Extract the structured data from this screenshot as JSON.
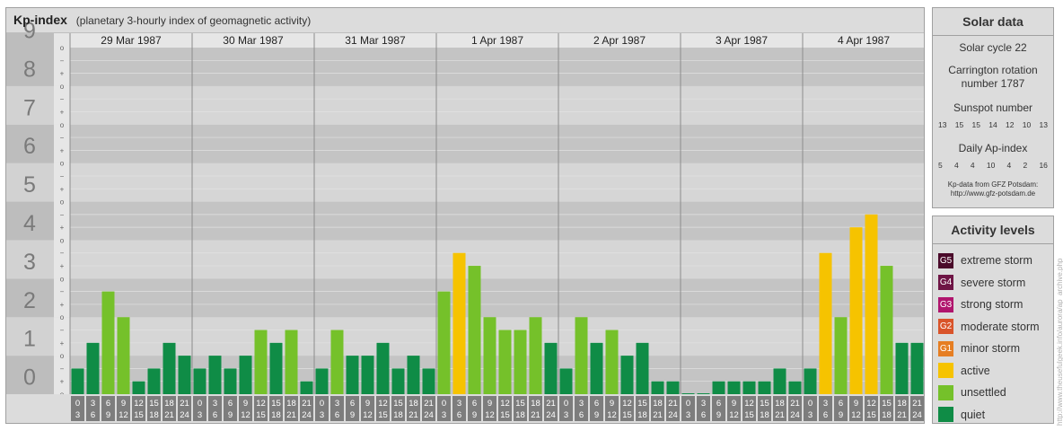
{
  "header": {
    "title": "Kp-index",
    "subtitle": "(planetary 3-hourly index of geomagnetic activity)"
  },
  "chart_data": {
    "type": "bar",
    "ylim": [
      0,
      9
    ],
    "y_major_ticks": [
      "0",
      "1",
      "2",
      "3",
      "4",
      "5",
      "6",
      "7",
      "8",
      "9"
    ],
    "y_minor_ticks": [
      "−",
      "o",
      "+"
    ],
    "days": [
      "29 Mar 1987",
      "30 Mar 1987",
      "31 Mar 1987",
      "1 Apr 1987",
      "2 Apr 1987",
      "3 Apr 1987",
      "4 Apr 1987"
    ],
    "hour_ticks_top": [
      "0",
      "3",
      "6",
      "9",
      "12",
      "15",
      "18",
      "21"
    ],
    "hour_ticks_bottom": [
      "3",
      "6",
      "9",
      "12",
      "15",
      "18",
      "21",
      "24"
    ],
    "values": [
      [
        0.667,
        1.333,
        2.667,
        2.0,
        0.333,
        0.667,
        1.333,
        1.0
      ],
      [
        0.667,
        1.0,
        0.667,
        1.0,
        1.667,
        1.333,
        1.667,
        0.333
      ],
      [
        0.667,
        1.667,
        1.0,
        1.0,
        1.333,
        0.667,
        1.0,
        0.667
      ],
      [
        2.667,
        3.667,
        3.333,
        2.0,
        1.667,
        1.667,
        2.0,
        1.333
      ],
      [
        0.667,
        2.0,
        1.333,
        1.667,
        1.0,
        1.333,
        0.333,
        0.333
      ],
      [
        0.0,
        0.0,
        0.333,
        0.333,
        0.333,
        0.333,
        0.667,
        0.333
      ],
      [
        0.667,
        3.667,
        2.0,
        4.333,
        4.667,
        3.333,
        1.333,
        1.333
      ]
    ],
    "colors": {
      "quiet": "#0f8c46",
      "unsettled": "#75c12a",
      "active": "#f6c300",
      "G1": "#e67e22",
      "G2": "#d9542a",
      "G3": "#b0156d",
      "G4": "#6e1545",
      "G5": "#4a0a2a"
    }
  },
  "solar": {
    "title": "Solar data",
    "cycle": "Solar cycle 22",
    "carrington_l1": "Carrington rotation",
    "carrington_l2": "number 1787",
    "sunspot_label": "Sunspot number",
    "sunspot_values": [
      "13",
      "15",
      "15",
      "14",
      "12",
      "10",
      "13"
    ],
    "ap_label": "Daily Ap-index",
    "ap_values": [
      "5",
      "4",
      "4",
      "10",
      "4",
      "2",
      "16"
    ],
    "source_l1": "Kp-data from GFZ Potsdam:",
    "source_l2": "http://www.gfz-potsdam.de"
  },
  "activity": {
    "title": "Activity levels",
    "levels": [
      {
        "badge": "G5",
        "label": "extreme storm",
        "color": "#4a0a2a"
      },
      {
        "badge": "G4",
        "label": "severe storm",
        "color": "#6e1545"
      },
      {
        "badge": "G3",
        "label": "strong storm",
        "color": "#b0156d"
      },
      {
        "badge": "G2",
        "label": "moderate storm",
        "color": "#d9542a"
      },
      {
        "badge": "G1",
        "label": "minor storm",
        "color": "#e67e22"
      },
      {
        "badge": "",
        "label": "active",
        "color": "#f6c300"
      },
      {
        "badge": "",
        "label": "unsettled",
        "color": "#75c12a"
      },
      {
        "badge": "",
        "label": "quiet",
        "color": "#0f8c46"
      }
    ]
  },
  "watermark": "http://www.theusefulgeek.info/aurora/ap_archive.php"
}
